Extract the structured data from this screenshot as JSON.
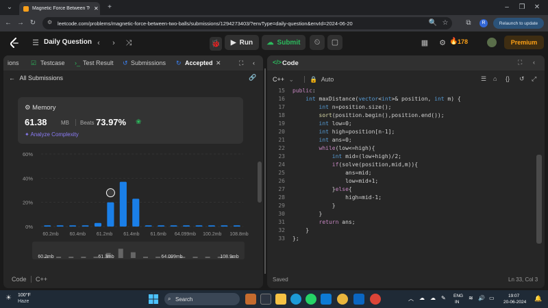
{
  "browser": {
    "tab_title": "Magnetic Force Between Two Balls",
    "url": "leetcode.com/problems/magnetic-force-between-two-balls/submissions/1294273403/?envType=daily-question&envId=2024-06-20",
    "relaunch_label": "Relaunch to update",
    "profile_initial": "R"
  },
  "header": {
    "title": "Daily Question",
    "run_label": "Run",
    "submit_label": "Submit",
    "streak": "178",
    "premium_label": "Premium"
  },
  "left": {
    "tabs": [
      "ions",
      "Testcase",
      "Test Result",
      "Submissions",
      "Accepted"
    ],
    "back_label": "All Submissions",
    "memory_label": "Memory",
    "memory_value": "61.38",
    "memory_unit": "MB",
    "beats_label": "Beats",
    "beats_value": "73.97%",
    "analyze_label": "Analyze Complexity",
    "footer_left": "Code",
    "footer_right": "C++"
  },
  "chart_data": {
    "type": "bar",
    "ylim": [
      0,
      60
    ],
    "y_ticks": [
      "60%",
      "40%",
      "20%",
      "0%"
    ],
    "x_tick_labels": [
      "60.2mb",
      "60.4mb",
      "61.2mb",
      "61.4mb",
      "61.6mb",
      "64.099mb",
      "100.2mb",
      "108.8mb"
    ],
    "values": [
      1,
      1,
      1,
      1,
      3,
      20,
      37,
      23,
      1,
      1,
      1,
      1,
      1,
      1,
      1,
      1
    ],
    "highlight_index": 5,
    "overview_labels": [
      "60.2mb",
      "61.3mb",
      "64.099mb",
      "108.9mb"
    ],
    "colors": {
      "bar": "#1a7fe8",
      "grid": "#3a3a3a"
    }
  },
  "right": {
    "title": "Code",
    "language": "C++",
    "auto_label": "Auto",
    "status_left": "Saved",
    "status_right": "Ln 33, Col 3"
  },
  "code": {
    "start_line": 15,
    "lines": [
      "public:",
      "    int maxDistance(vector<int>& position, int m) {",
      "        int n=position.size();",
      "        sort(position.begin(),position.end());",
      "        int low=0;",
      "        int high=position[n-1];",
      "        int ans=0;",
      "        while(low<=high){",
      "            int mid=(low+high)/2;",
      "            if(solve(position,mid,m)){",
      "                ans=mid;",
      "                low=mid+1;",
      "            }else{",
      "                high=mid-1;",
      "            }",
      "        }",
      "        return ans;",
      "    }",
      "};"
    ]
  },
  "taskbar": {
    "temp": "100°F",
    "weather": "Haze",
    "search_label": "Search",
    "lang_top": "ENG",
    "lang_bottom": "IN",
    "time": "19:07",
    "date": "20-06-2024"
  }
}
